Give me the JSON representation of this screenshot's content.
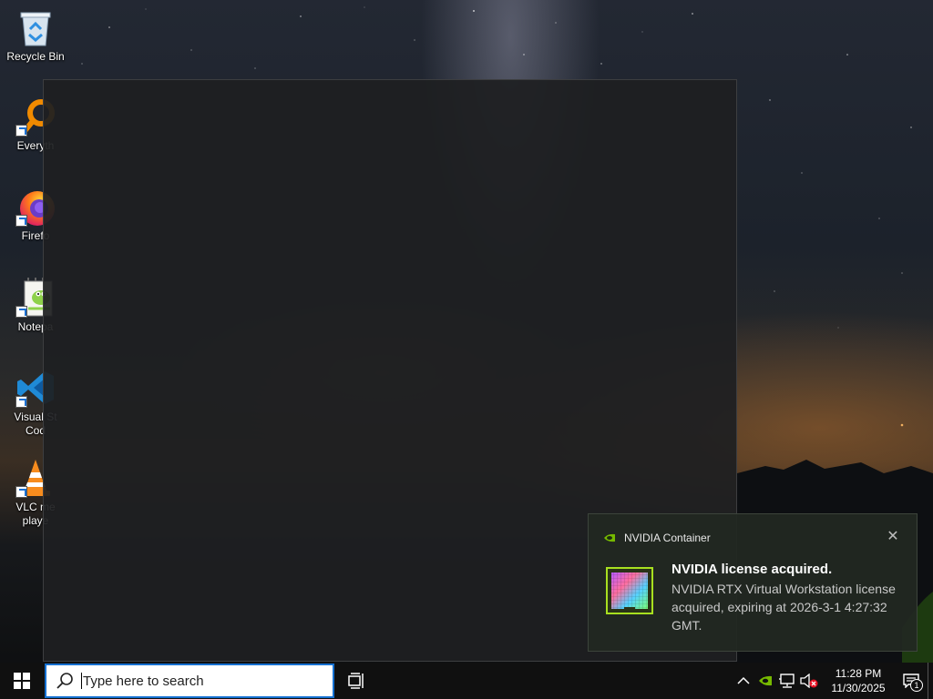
{
  "desktop": {
    "icons": [
      {
        "label": "Recycle Bin",
        "icon": "recycle-bin-icon"
      },
      {
        "label": "Everyth",
        "icon": "everything-search-icon"
      },
      {
        "label": "Firefo",
        "icon": "firefox-icon"
      },
      {
        "label": "Notepa",
        "icon": "notepad-plus-plus-icon"
      },
      {
        "label": "Visual St\nCod",
        "icon": "vscode-icon"
      },
      {
        "label": "VLC me\nplaye",
        "icon": "vlc-icon"
      }
    ]
  },
  "notification": {
    "app_name": "NVIDIA Container",
    "title": "NVIDIA license acquired.",
    "body": "NVIDIA RTX Virtual Workstation license acquired, expiring at 2026-3-1 4:27:32 GMT.",
    "close_icon": "close-icon",
    "accent": "#76b900"
  },
  "taskbar": {
    "search_placeholder": "Type here to search",
    "clock_time": "11:28 PM",
    "clock_date": "11/30/2025",
    "notification_count": "1",
    "accent": "#1570d1"
  }
}
